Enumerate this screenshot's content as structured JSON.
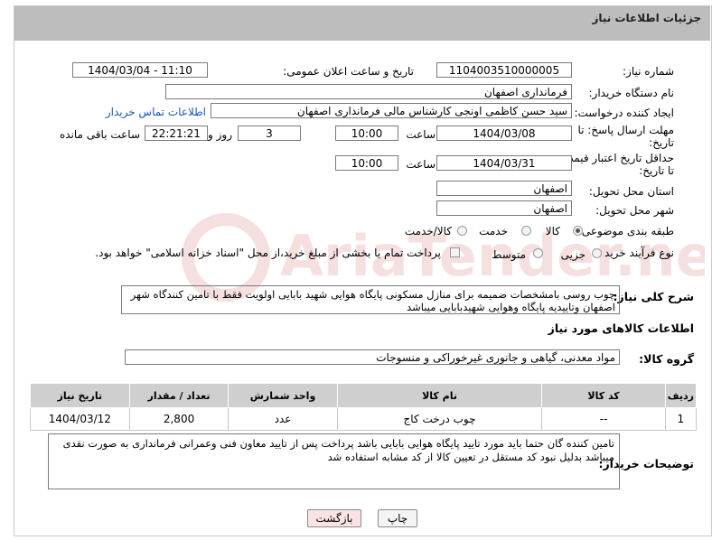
{
  "header": {
    "title": "جزئیات اطلاعات نیاز"
  },
  "form": {
    "need_number_label": "شماره نیاز:",
    "need_number": "1104003510000005",
    "announce_label": "تاریخ و ساعت اعلان عمومی:",
    "announce_value": "1404/03/04 - 11:10",
    "buyer_org_label": "نام دستگاه خریدار:",
    "buyer_org": "فرمانداری اصفهان",
    "creator_label": "ایجاد کننده درخواست:",
    "creator": "سید حسن  کاظمی اونجی کارشناس مالی  فرمانداری اصفهان",
    "contact_link": "اطلاعات تماس خریدار",
    "deadline_label_1": "مهلت ارسال پاسخ: تا",
    "deadline_label_2": "تاریخ:",
    "deadline_date": "1404/03/08",
    "time_label": "ساعت",
    "deadline_time": "10:00",
    "days_value": "3",
    "days_label": "روز و",
    "remaining_time": "22:21:21",
    "remaining_label": "ساعت باقی مانده",
    "validity_label_1": "حداقل تاریخ اعتبار قیمت:",
    "validity_label_2": "تا تاریخ:",
    "validity_date": "1404/03/31",
    "validity_time": "10:00",
    "province_label": "استان محل تحویل:",
    "province": "اصفهان",
    "city_label": "شهر محل تحویل:",
    "city": "اصفهان",
    "category_label": "طبقه بندی موضوعی:",
    "category_options": [
      "کالا",
      "خدمت",
      "کالا/خدمت"
    ],
    "process_label": "نوع فرآیند خرید :",
    "process_options": [
      "جزیی",
      "متوسط"
    ],
    "payment_note": "پرداخت تمام یا بخشی از مبلغ خرید،از محل \"اسناد خزانه اسلامی\" خواهد بود."
  },
  "description": {
    "label": "شرح کلی نیاز:",
    "text": "چوب روسی بامشخصات ضمیمه برای منازل مسکونی پایگاه هوایی شهید بابایی اولویت فقط با تامین کنندگاه شهر اصفهان وتاییدیه پایگاه وهوایی شهیدبابایی میباشد"
  },
  "goods_section_title": "اطلاعات کالاهای مورد نیاز",
  "goods_group_label": "گروه کالا:",
  "goods_group": "مواد معدنی، گیاهی و جانوری غیرخوراکی و منسوجات",
  "table": {
    "headers": [
      "ردیف",
      "کد کالا",
      "نام کالا",
      "واحد شمارش",
      "تعداد / مقدار",
      "تاریخ نیاز"
    ],
    "rows": [
      [
        "1",
        "--",
        "چوب درخت کاج",
        "عدد",
        "2,800",
        "1404/03/12"
      ]
    ]
  },
  "buyer_notes": {
    "label": "توضیحات خریدار:",
    "text": "تامین کننده گان حتما باید مورد تایید پایگاه هوایی بابایی باشد پرداخت پس از تایید معاون فنی وعمرانی فرمانداری به صورت نقدی میباشد  بدلیل نبود کد مستقل در تعیین کالا از کد مشابه استفاده شد"
  },
  "buttons": {
    "print": "چاپ",
    "back": "بازگشت"
  },
  "colors": {
    "header_bg": "#bdbdbd",
    "link": "#1a56b8",
    "back_button_bg": "#fbe3e3"
  },
  "watermark": {
    "text": "AriaTender.neT"
  }
}
